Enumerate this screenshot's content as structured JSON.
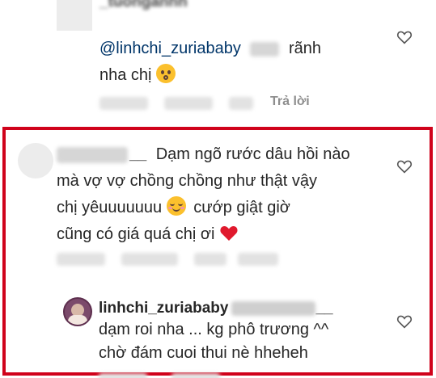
{
  "comments": [
    {
      "id": "comment-1",
      "username": "_tuonganhh",
      "mention": "@linhchi_zuriababy",
      "text_after_mention": "rãnh",
      "text_line2": "nha chị",
      "emoji": "kissing-face-emoji",
      "reply_label": "Trả lời"
    },
    {
      "id": "comment-2",
      "username_suffix": "__",
      "text_line1": "Dạm ngõ rước dâu hồi nào",
      "text_line2": "mà vợ vợ chồng chồng như thật vậy",
      "text_line3a": "chị yêuuuuuuu",
      "text_line3b": "cướp giật giờ",
      "text_line4": "cũng có giá quá chị ơi",
      "emoji_1": "relieved-face-emoji",
      "emoji_2": "red-heart-emoji"
    },
    {
      "id": "reply-1",
      "username": "linhchi_zuriababy",
      "username_suffix": "__",
      "text_line1": "dạm roi nha ... kg phô trương ^^",
      "text_line2": "chờ đám cuoi thui nè hheheh"
    }
  ],
  "colors": {
    "highlight_border": "#d0021b",
    "text": "#262626",
    "mention": "#003569",
    "muted": "#8e8e8e"
  },
  "icons": [
    "heart-outline-icon"
  ]
}
